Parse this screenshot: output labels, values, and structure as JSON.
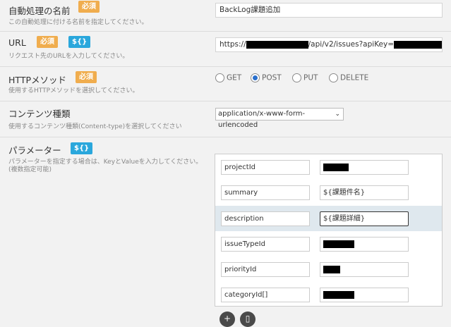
{
  "rows": {
    "name": {
      "label": "自動処理の名前",
      "badge": "必須",
      "help": "この自動処理に付ける名前を指定してください。",
      "value": "BackLog課題追加"
    },
    "url": {
      "label": "URL",
      "badge": "必須",
      "var_badge": "${}",
      "help": "リクエスト先のURLを入力してください。",
      "value_prefix": "https://",
      "value_middle": "/api/v2/issues?apiKey="
    },
    "method": {
      "label": "HTTPメソッド",
      "badge": "必須",
      "help": "使用するHTTPメソッドを選択してください。",
      "options": [
        "GET",
        "POST",
        "PUT",
        "DELETE"
      ],
      "selected": "POST"
    },
    "content_type": {
      "label": "コンテンツ種類",
      "help": "使用するコンテンツ種類(Content-type)を選択してください",
      "selected": "application/x-www-form-urlencoded"
    },
    "params": {
      "label": "パラメーター",
      "var_badge": "${}",
      "help_line1": "パラメーターを指定する場合は、KeyとValueを入力してください。",
      "help_line2": "(複数指定可能)"
    }
  },
  "params": [
    {
      "key": "projectId",
      "value": "",
      "redacted": true
    },
    {
      "key": "summary",
      "value": "${課題件名}",
      "redacted": false
    },
    {
      "key": "description",
      "value": "${課題詳細}",
      "redacted": false
    },
    {
      "key": "issueTypeId",
      "value": "",
      "redacted": true
    },
    {
      "key": "priorityId",
      "value": "",
      "redacted": true
    },
    {
      "key": "categoryId[]",
      "value": "",
      "redacted": true
    }
  ],
  "icons": {
    "add": "plus-icon",
    "delete": "trash-icon",
    "select_arrow": "chevron-down-icon"
  }
}
